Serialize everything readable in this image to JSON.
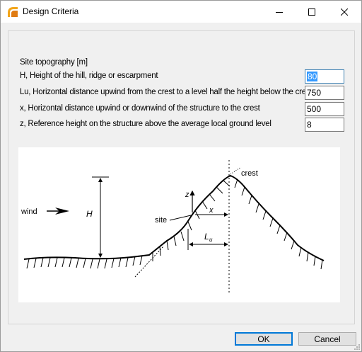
{
  "window": {
    "title": "Design Criteria"
  },
  "section_label": "Site topography [m]",
  "rows": [
    {
      "label": "H,  Height of the hill, ridge or escarpment",
      "value": "80"
    },
    {
      "label": "Lu, Horizontal distance upwind from the crest to a level half the height below the crest",
      "value": "750"
    },
    {
      "label": "x,  Horizontal distance upwind or downwind of the structure to the crest",
      "value": "500"
    },
    {
      "label": "z,  Reference height on the structure above the average local ground level",
      "value": "8"
    }
  ],
  "diagram": {
    "wind": "wind",
    "H": "H",
    "site": "site",
    "crest": "crest",
    "x": "x",
    "z": "z",
    "Lu_main": "L",
    "Lu_sub": "u"
  },
  "buttons": {
    "ok": "OK",
    "cancel": "Cancel"
  },
  "icons": {
    "app": "app-logo-icon",
    "minimize": "minimize-icon",
    "maximize": "maximize-icon",
    "close": "close-icon"
  }
}
